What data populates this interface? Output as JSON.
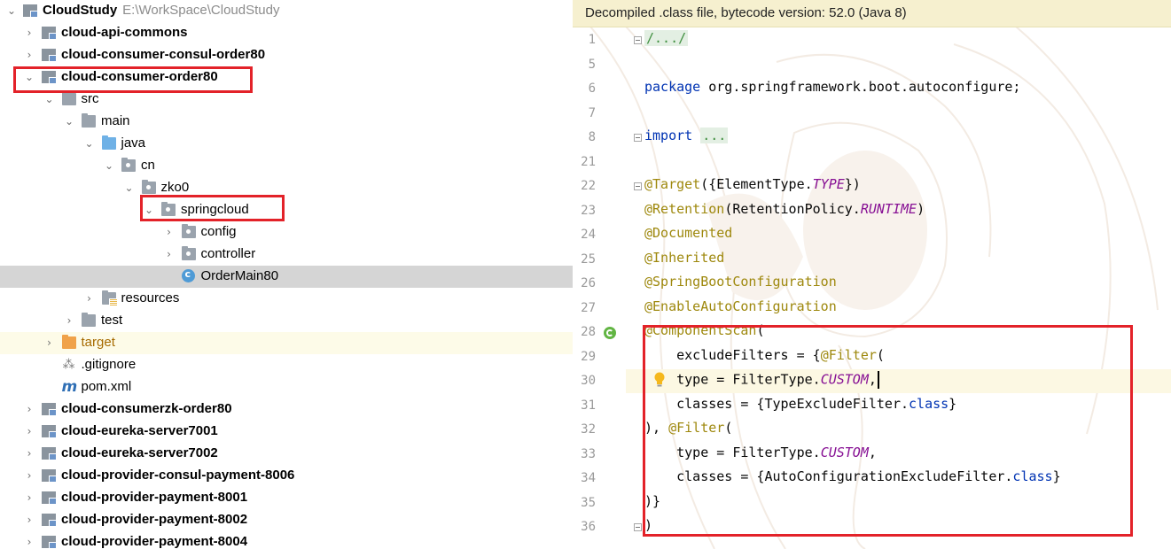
{
  "project": {
    "name": "CloudStudy",
    "path": "E:\\WorkSpace\\CloudStudy"
  },
  "tree": [
    {
      "label": "cloud-api-commons",
      "depth": 0,
      "kind": "module",
      "arrow": "›",
      "bold": true
    },
    {
      "label": "cloud-consumer-consul-order80",
      "depth": 0,
      "kind": "module",
      "arrow": "›",
      "bold": true
    },
    {
      "label": "cloud-consumer-order80",
      "depth": 0,
      "kind": "module",
      "arrow": "⌄",
      "bold": true
    },
    {
      "label": "src",
      "depth": 1,
      "kind": "folder",
      "arrow": "⌄"
    },
    {
      "label": "main",
      "depth": 2,
      "kind": "folder",
      "arrow": "⌄"
    },
    {
      "label": "java",
      "depth": 3,
      "kind": "folder-blue",
      "arrow": "⌄"
    },
    {
      "label": "cn",
      "depth": 4,
      "kind": "package",
      "arrow": "⌄"
    },
    {
      "label": "zko0",
      "depth": 5,
      "kind": "package",
      "arrow": "⌄"
    },
    {
      "label": "springcloud",
      "depth": 6,
      "kind": "package",
      "arrow": "⌄"
    },
    {
      "label": "config",
      "depth": 7,
      "kind": "package",
      "arrow": "›"
    },
    {
      "label": "controller",
      "depth": 7,
      "kind": "package",
      "arrow": "›"
    },
    {
      "label": "OrderMain80",
      "depth": 7,
      "kind": "class",
      "arrow": "",
      "selected": true
    },
    {
      "label": "resources",
      "depth": 3,
      "kind": "resources",
      "arrow": "›"
    },
    {
      "label": "test",
      "depth": 2,
      "kind": "folder",
      "arrow": "›"
    },
    {
      "label": "target",
      "depth": 1,
      "kind": "folder-orange",
      "arrow": "›",
      "excluded": true
    },
    {
      "label": ".gitignore",
      "depth": 1,
      "kind": "git",
      "arrow": ""
    },
    {
      "label": "pom.xml",
      "depth": 1,
      "kind": "maven",
      "arrow": ""
    },
    {
      "label": "cloud-consumerzk-order80",
      "depth": 0,
      "kind": "module",
      "arrow": "›",
      "bold": true
    },
    {
      "label": "cloud-eureka-server7001",
      "depth": 0,
      "kind": "module",
      "arrow": "›",
      "bold": true
    },
    {
      "label": "cloud-eureka-server7002",
      "depth": 0,
      "kind": "module",
      "arrow": "›",
      "bold": true
    },
    {
      "label": "cloud-provider-consul-payment-8006",
      "depth": 0,
      "kind": "module",
      "arrow": "›",
      "bold": true
    },
    {
      "label": "cloud-provider-payment-8001",
      "depth": 0,
      "kind": "module",
      "arrow": "›",
      "bold": true
    },
    {
      "label": "cloud-provider-payment-8002",
      "depth": 0,
      "kind": "module",
      "arrow": "›",
      "bold": true
    },
    {
      "label": "cloud-provider-payment-8004",
      "depth": 0,
      "kind": "module",
      "arrow": "›",
      "bold": true
    }
  ],
  "editor": {
    "banner": "Decompiled .class file, bytecode version: 52.0 (Java 8)",
    "lines": [
      {
        "num": "1",
        "segs": [
          {
            "t": "/.../",
            "c": "fold-bg"
          }
        ],
        "fold": true
      },
      {
        "num": "5",
        "segs": []
      },
      {
        "num": "6",
        "segs": [
          {
            "t": "package",
            "c": "kw"
          },
          {
            "t": " org.springframework.boot.autoconfigure;",
            "c": ""
          }
        ]
      },
      {
        "num": "7",
        "segs": []
      },
      {
        "num": "8",
        "segs": [
          {
            "t": "import",
            "c": "kw"
          },
          {
            "t": " ",
            "c": ""
          },
          {
            "t": "...",
            "c": "fold-bg"
          }
        ],
        "fold": true
      },
      {
        "num": "21",
        "segs": []
      },
      {
        "num": "22",
        "segs": [
          {
            "t": "@Target",
            "c": "an"
          },
          {
            "t": "({ElementType.",
            "c": ""
          },
          {
            "t": "TYPE",
            "c": "it"
          },
          {
            "t": "})",
            "c": ""
          }
        ],
        "fold": true
      },
      {
        "num": "23",
        "segs": [
          {
            "t": "@Retention",
            "c": "an"
          },
          {
            "t": "(RetentionPolicy.",
            "c": ""
          },
          {
            "t": "RUNTIME",
            "c": "it"
          },
          {
            "t": ")",
            "c": ""
          }
        ]
      },
      {
        "num": "24",
        "segs": [
          {
            "t": "@Documented",
            "c": "an"
          }
        ]
      },
      {
        "num": "25",
        "segs": [
          {
            "t": "@Inherited",
            "c": "an"
          }
        ]
      },
      {
        "num": "26",
        "segs": [
          {
            "t": "@SpringBootConfiguration",
            "c": "an"
          }
        ]
      },
      {
        "num": "27",
        "segs": [
          {
            "t": "@EnableAutoConfiguration",
            "c": "an"
          }
        ]
      },
      {
        "num": "28",
        "segs": [
          {
            "t": "@ComponentScan",
            "c": "an"
          },
          {
            "t": "(",
            "c": ""
          }
        ],
        "spring": true
      },
      {
        "num": "29",
        "segs": [
          {
            "t": "    excludeFilters = {",
            "c": ""
          },
          {
            "t": "@Filter",
            "c": "an"
          },
          {
            "t": "(",
            "c": ""
          }
        ]
      },
      {
        "num": "30",
        "segs": [
          {
            "t": "    type = FilterType.",
            "c": ""
          },
          {
            "t": "CUSTOM",
            "c": "it"
          },
          {
            "t": ",",
            "c": ""
          }
        ],
        "caret": true,
        "bulb": true
      },
      {
        "num": "31",
        "segs": [
          {
            "t": "    classes = {TypeExcludeFilter.",
            "c": ""
          },
          {
            "t": "class",
            "c": "kw"
          },
          {
            "t": "}",
            "c": ""
          }
        ]
      },
      {
        "num": "32",
        "segs": [
          {
            "t": "), ",
            "c": ""
          },
          {
            "t": "@Filter",
            "c": "an"
          },
          {
            "t": "(",
            "c": ""
          }
        ]
      },
      {
        "num": "33",
        "segs": [
          {
            "t": "    type = FilterType.",
            "c": ""
          },
          {
            "t": "CUSTOM",
            "c": "it"
          },
          {
            "t": ",",
            "c": ""
          }
        ]
      },
      {
        "num": "34",
        "segs": [
          {
            "t": "    classes = {AutoConfigurationExcludeFilter.",
            "c": ""
          },
          {
            "t": "class",
            "c": "kw"
          },
          {
            "t": "}",
            "c": ""
          }
        ]
      },
      {
        "num": "35",
        "segs": [
          {
            "t": ")}",
            "c": ""
          }
        ]
      },
      {
        "num": "36",
        "segs": [
          {
            "t": ")",
            "c": ""
          }
        ],
        "fold": true
      }
    ]
  },
  "colors": {
    "highlight_box": "#e32229",
    "selected_row": "#d5d5d5",
    "banner_bg": "#f6f0cf"
  }
}
